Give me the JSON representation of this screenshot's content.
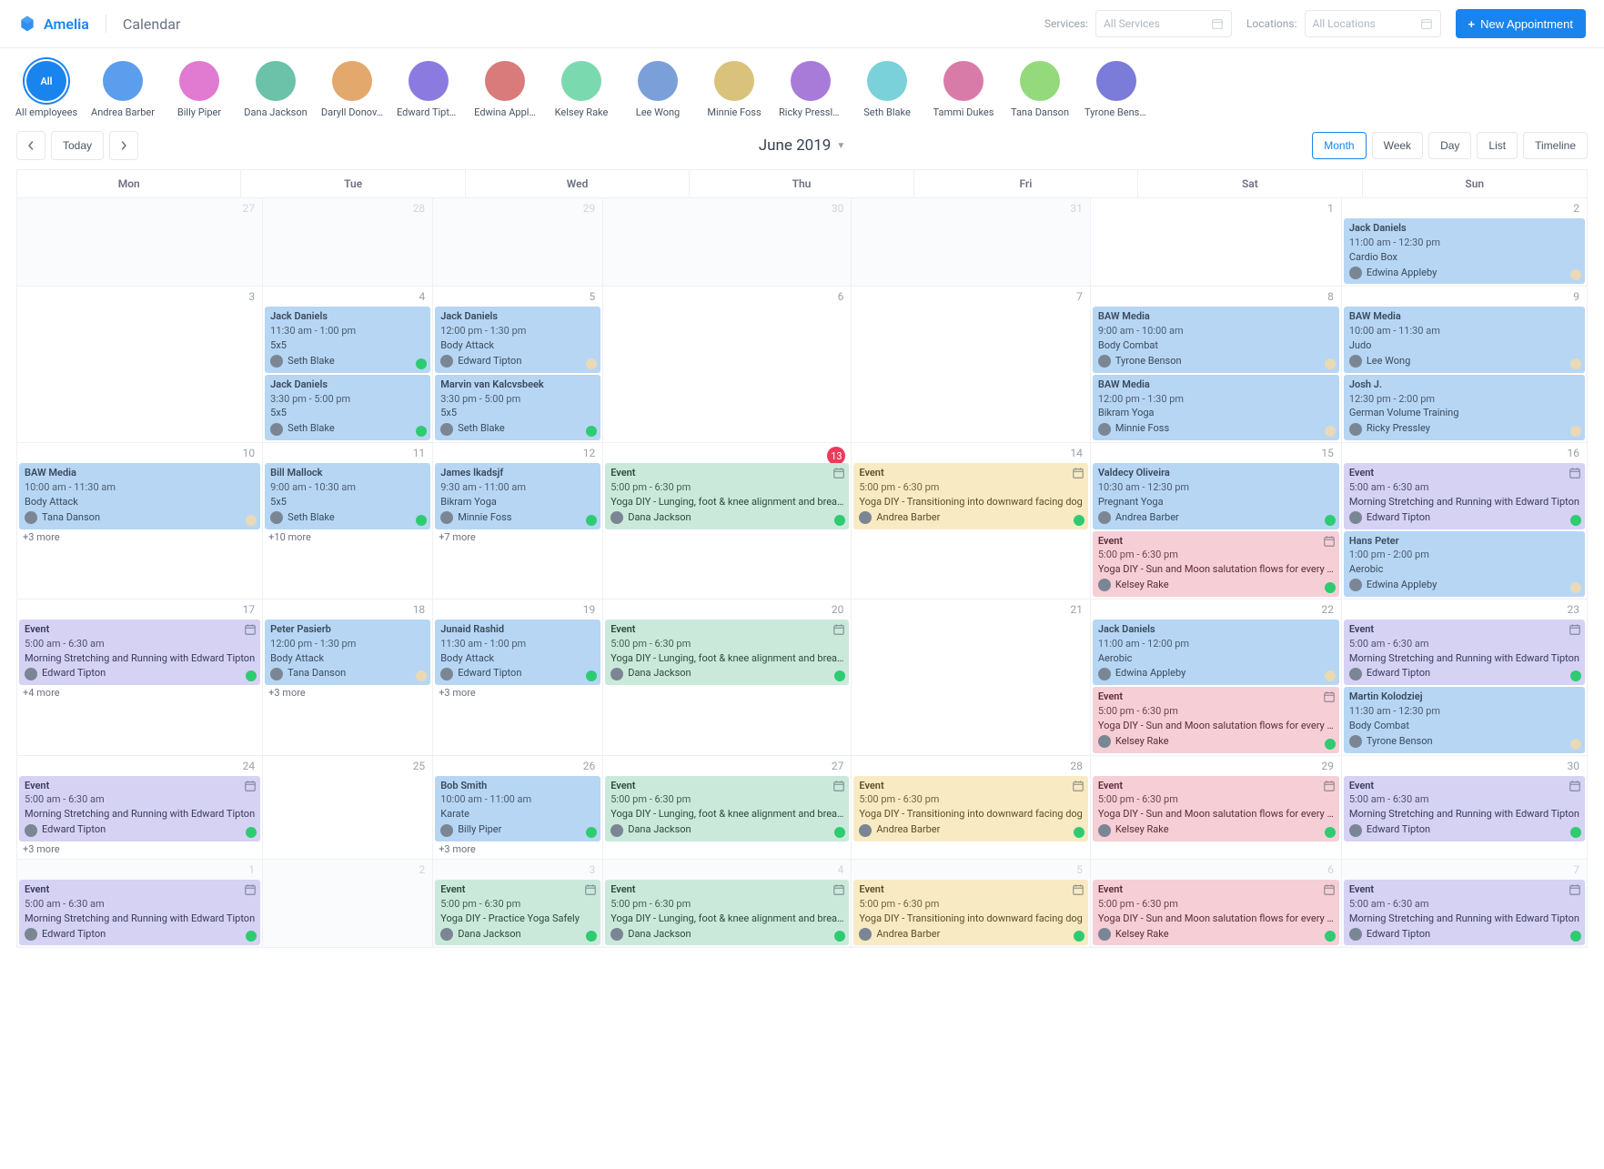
{
  "brand": "Amelia",
  "page_title": "Calendar",
  "filters": {
    "services_label": "Services:",
    "services_placeholder": "All Services",
    "locations_label": "Locations:",
    "locations_placeholder": "All Locations"
  },
  "new_appointment_label": "New Appointment",
  "employees": [
    {
      "label": "All employees",
      "avatar_text": "All",
      "all": true
    },
    {
      "label": "Andrea Barber"
    },
    {
      "label": "Billy Piper"
    },
    {
      "label": "Dana Jackson"
    },
    {
      "label": "Daryll Donov…"
    },
    {
      "label": "Edward Tipton"
    },
    {
      "label": "Edwina Appl…"
    },
    {
      "label": "Kelsey Rake"
    },
    {
      "label": "Lee Wong"
    },
    {
      "label": "Minnie Foss"
    },
    {
      "label": "Ricky Pressley"
    },
    {
      "label": "Seth Blake"
    },
    {
      "label": "Tammi Dukes"
    },
    {
      "label": "Tana Danson"
    },
    {
      "label": "Tyrone Benson"
    }
  ],
  "toolbar": {
    "today_label": "Today",
    "month_title": "June 2019",
    "views": [
      "Month",
      "Week",
      "Day",
      "List",
      "Timeline"
    ],
    "active_view": "Month"
  },
  "day_headers": [
    "Mon",
    "Tue",
    "Wed",
    "Thu",
    "Fri",
    "Sat",
    "Sun"
  ],
  "weeks": [
    {
      "days": [
        {
          "num": "27",
          "other": true,
          "events": []
        },
        {
          "num": "28",
          "other": true,
          "events": []
        },
        {
          "num": "29",
          "other": true,
          "events": []
        },
        {
          "num": "30",
          "other": true,
          "events": []
        },
        {
          "num": "31",
          "other": true,
          "events": []
        },
        {
          "num": "1",
          "events": []
        },
        {
          "num": "2",
          "events": [
            {
              "color": "blue",
              "title": "Jack Daniels",
              "time": "11:00 am - 12:30 pm",
              "service": "Cardio Box",
              "assignee": "Edwina Appleby",
              "status": "beige"
            }
          ]
        }
      ]
    },
    {
      "days": [
        {
          "num": "3",
          "events": []
        },
        {
          "num": "4",
          "events": [
            {
              "color": "blue",
              "title": "Jack Daniels",
              "time": "11:30 am - 1:00 pm",
              "service": "5x5",
              "assignee": "Seth Blake",
              "status": "green"
            },
            {
              "color": "blue",
              "title": "Jack Daniels",
              "time": "3:30 pm - 5:00 pm",
              "service": "5x5",
              "assignee": "Seth Blake",
              "status": "green"
            }
          ]
        },
        {
          "num": "5",
          "events": [
            {
              "color": "blue",
              "title": "Jack Daniels",
              "time": "12:00 pm - 1:30 pm",
              "service": "Body Attack",
              "assignee": "Edward Tipton",
              "status": "beige"
            },
            {
              "color": "blue",
              "title": "Marvin van Kalcvsbeek",
              "time": "3:30 pm - 5:00 pm",
              "service": "5x5",
              "assignee": "Seth Blake",
              "status": "green"
            }
          ]
        },
        {
          "num": "6",
          "events": []
        },
        {
          "num": "7",
          "events": []
        },
        {
          "num": "8",
          "events": [
            {
              "color": "blue",
              "title": "BAW Media",
              "time": "9:00 am - 10:00 am",
              "service": "Body Combat",
              "assignee": "Tyrone Benson",
              "status": "beige"
            },
            {
              "color": "blue",
              "title": "BAW Media",
              "time": "12:00 pm - 1:30 pm",
              "service": "Bikram Yoga",
              "assignee": "Minnie Foss",
              "status": "beige"
            }
          ]
        },
        {
          "num": "9",
          "events": [
            {
              "color": "blue",
              "title": "BAW Media",
              "time": "10:00 am - 11:30 am",
              "service": "Judo",
              "assignee": "Lee Wong",
              "status": "beige"
            },
            {
              "color": "blue",
              "title": "Josh J.",
              "time": "12:30 pm - 2:00 pm",
              "service": "German Volume Training",
              "assignee": "Ricky Pressley",
              "status": "beige"
            }
          ]
        }
      ]
    },
    {
      "days": [
        {
          "num": "10",
          "events": [
            {
              "color": "blue",
              "title": "BAW Media",
              "time": "10:00 am - 11:30 am",
              "service": "Body Attack",
              "assignee": "Tana Danson",
              "status": "beige"
            }
          ],
          "more": "+3 more"
        },
        {
          "num": "11",
          "events": [
            {
              "color": "blue",
              "title": "Bill Mallock",
              "time": "9:00 am - 10:30 am",
              "service": "5x5",
              "assignee": "Seth Blake",
              "status": "green"
            }
          ],
          "more": "+10 more"
        },
        {
          "num": "12",
          "events": [
            {
              "color": "blue",
              "title": "James lkadsjf",
              "time": "9:30 am - 11:00 am",
              "service": "Bikram Yoga",
              "assignee": "Minnie Foss",
              "status": "green"
            }
          ],
          "more": "+7 more"
        },
        {
          "num": "13",
          "today": true,
          "events": [
            {
              "color": "teal",
              "title": "Event",
              "time": "5:00 pm - 6:30 pm",
              "service": "Yoga DIY - Lunging, foot & knee alignment and brea…",
              "assignee": "Dana Jackson",
              "status": "green",
              "corner": "cal"
            }
          ]
        },
        {
          "num": "14",
          "events": [
            {
              "color": "yellow",
              "title": "Event",
              "time": "5:00 pm - 6:30 pm",
              "service": "Yoga DIY - Transitioning into downward facing dog",
              "assignee": "Andrea Barber",
              "status": "green",
              "corner": "cal"
            }
          ]
        },
        {
          "num": "15",
          "events": [
            {
              "color": "blue",
              "title": "Valdecy Oliveira",
              "time": "10:30 am - 12:30 pm",
              "service": "Pregnant Yoga",
              "assignee": "Andrea Barber",
              "status": "green"
            },
            {
              "color": "pink",
              "title": "Event",
              "time": "5:00 pm - 6:30 pm",
              "service": "Yoga DIY - Sun and Moon salutation flows for every …",
              "assignee": "Kelsey Rake",
              "status": "green",
              "corner": "cal"
            }
          ]
        },
        {
          "num": "16",
          "events": [
            {
              "color": "purple",
              "title": "Event",
              "time": "5:00 am - 6:30 am",
              "service": "Morning Stretching and Running with Edward Tipton",
              "assignee": "Edward Tipton",
              "status": "green",
              "corner": "cal"
            },
            {
              "color": "blue",
              "title": "Hans Peter",
              "time": "1:00 pm - 2:00 pm",
              "service": "Aerobic",
              "assignee": "Edwina Appleby",
              "status": "beige"
            }
          ]
        }
      ]
    },
    {
      "days": [
        {
          "num": "17",
          "events": [
            {
              "color": "purple",
              "title": "Event",
              "time": "5:00 am - 6:30 am",
              "service": "Morning Stretching and Running with Edward Tipton",
              "assignee": "Edward Tipton",
              "status": "green",
              "corner": "cal"
            }
          ],
          "more": "+4 more"
        },
        {
          "num": "18",
          "events": [
            {
              "color": "blue",
              "title": "Peter Pasierb",
              "time": "12:00 pm - 1:30 pm",
              "service": "Body Attack",
              "assignee": "Tana Danson",
              "status": "beige"
            }
          ],
          "more": "+3 more"
        },
        {
          "num": "19",
          "events": [
            {
              "color": "blue",
              "title": "Junaid Rashid",
              "time": "11:30 am - 1:00 pm",
              "service": "Body Attack",
              "assignee": "Edward Tipton",
              "status": "green"
            }
          ],
          "more": "+3 more"
        },
        {
          "num": "20",
          "events": [
            {
              "color": "teal",
              "title": "Event",
              "time": "5:00 pm - 6:30 pm",
              "service": "Yoga DIY - Lunging, foot & knee alignment and brea…",
              "assignee": "Dana Jackson",
              "status": "green",
              "corner": "cal"
            }
          ]
        },
        {
          "num": "21",
          "events": []
        },
        {
          "num": "22",
          "events": [
            {
              "color": "blue",
              "title": "Jack Daniels",
              "time": "11:00 am - 12:00 pm",
              "service": "Aerobic",
              "assignee": "Edwina Appleby",
              "status": "beige"
            },
            {
              "color": "pink",
              "title": "Event",
              "time": "5:00 pm - 6:30 pm",
              "service": "Yoga DIY - Sun and Moon salutation flows for every …",
              "assignee": "Kelsey Rake",
              "status": "green",
              "corner": "cal"
            }
          ]
        },
        {
          "num": "23",
          "events": [
            {
              "color": "purple",
              "title": "Event",
              "time": "5:00 am - 6:30 am",
              "service": "Morning Stretching and Running with Edward Tipton",
              "assignee": "Edward Tipton",
              "status": "green",
              "corner": "cal"
            },
            {
              "color": "blue",
              "title": "Martin Kolodziej",
              "time": "11:30 am - 12:30 pm",
              "service": "Body Combat",
              "assignee": "Tyrone Benson",
              "status": "beige"
            }
          ]
        }
      ]
    },
    {
      "days": [
        {
          "num": "24",
          "events": [
            {
              "color": "purple",
              "title": "Event",
              "time": "5:00 am - 6:30 am",
              "service": "Morning Stretching and Running with Edward Tipton",
              "assignee": "Edward Tipton",
              "status": "green",
              "corner": "cal"
            }
          ],
          "more": "+3 more"
        },
        {
          "num": "25",
          "events": []
        },
        {
          "num": "26",
          "events": [
            {
              "color": "blue",
              "title": "Bob Smith",
              "time": "10:00 am - 11:00 am",
              "service": "Karate",
              "assignee": "Billy Piper",
              "status": "green"
            }
          ],
          "more": "+3 more"
        },
        {
          "num": "27",
          "events": [
            {
              "color": "teal",
              "title": "Event",
              "time": "5:00 pm - 6:30 pm",
              "service": "Yoga DIY - Lunging, foot & knee alignment and brea…",
              "assignee": "Dana Jackson",
              "status": "green",
              "corner": "cal"
            }
          ]
        },
        {
          "num": "28",
          "events": [
            {
              "color": "yellow",
              "title": "Event",
              "time": "5:00 pm - 6:30 pm",
              "service": "Yoga DIY - Transitioning into downward facing dog",
              "assignee": "Andrea Barber",
              "status": "green",
              "corner": "cal"
            }
          ]
        },
        {
          "num": "29",
          "events": [
            {
              "color": "pink",
              "title": "Event",
              "time": "5:00 pm - 6:30 pm",
              "service": "Yoga DIY - Sun and Moon salutation flows for every …",
              "assignee": "Kelsey Rake",
              "status": "green",
              "corner": "cal"
            }
          ]
        },
        {
          "num": "30",
          "events": [
            {
              "color": "purple",
              "title": "Event",
              "time": "5:00 am - 6:30 am",
              "service": "Morning Stretching and Running with Edward Tipton",
              "assignee": "Edward Tipton",
              "status": "green",
              "corner": "cal"
            }
          ]
        }
      ]
    },
    {
      "days": [
        {
          "num": "1",
          "other": true,
          "events": [
            {
              "color": "purple",
              "title": "Event",
              "time": "5:00 am - 6:30 am",
              "service": "Morning Stretching and Running with Edward Tipton",
              "assignee": "Edward Tipton",
              "status": "green",
              "corner": "cal"
            }
          ]
        },
        {
          "num": "2",
          "other": true,
          "events": []
        },
        {
          "num": "3",
          "other": true,
          "events": [
            {
              "color": "teal",
              "title": "Event",
              "time": "5:00 pm - 6:30 pm",
              "service": "Yoga DIY - Practice Yoga Safely",
              "assignee": "Dana Jackson",
              "status": "green",
              "corner": "cal"
            }
          ]
        },
        {
          "num": "4",
          "other": true,
          "events": [
            {
              "color": "teal",
              "title": "Event",
              "time": "5:00 pm - 6:30 pm",
              "service": "Yoga DIY - Lunging, foot & knee alignment and brea…",
              "assignee": "Dana Jackson",
              "status": "green",
              "corner": "cal"
            }
          ]
        },
        {
          "num": "5",
          "other": true,
          "events": [
            {
              "color": "yellow",
              "title": "Event",
              "time": "5:00 pm - 6:30 pm",
              "service": "Yoga DIY - Transitioning into downward facing dog",
              "assignee": "Andrea Barber",
              "status": "green",
              "corner": "cal"
            }
          ]
        },
        {
          "num": "6",
          "other": true,
          "events": [
            {
              "color": "pink",
              "title": "Event",
              "time": "5:00 pm - 6:30 pm",
              "service": "Yoga DIY - Sun and Moon salutation flows for every …",
              "assignee": "Kelsey Rake",
              "status": "green",
              "corner": "cal"
            }
          ]
        },
        {
          "num": "7",
          "other": true,
          "events": [
            {
              "color": "purple",
              "title": "Event",
              "time": "5:00 am - 6:30 am",
              "service": "Morning Stretching and Running with Edward Tipton",
              "assignee": "Edward Tipton",
              "status": "green",
              "corner": "cal"
            }
          ]
        }
      ]
    }
  ],
  "avatar_colors": [
    "#5c9ded",
    "#e07bd1",
    "#6cc2a8",
    "#e2a86c",
    "#8b7be0",
    "#d97b7b",
    "#7bd9b0",
    "#7b9fd9",
    "#d9c27b",
    "#a87bd9",
    "#7bd1d9",
    "#d97ba8",
    "#94d97b",
    "#7b7bd9"
  ]
}
